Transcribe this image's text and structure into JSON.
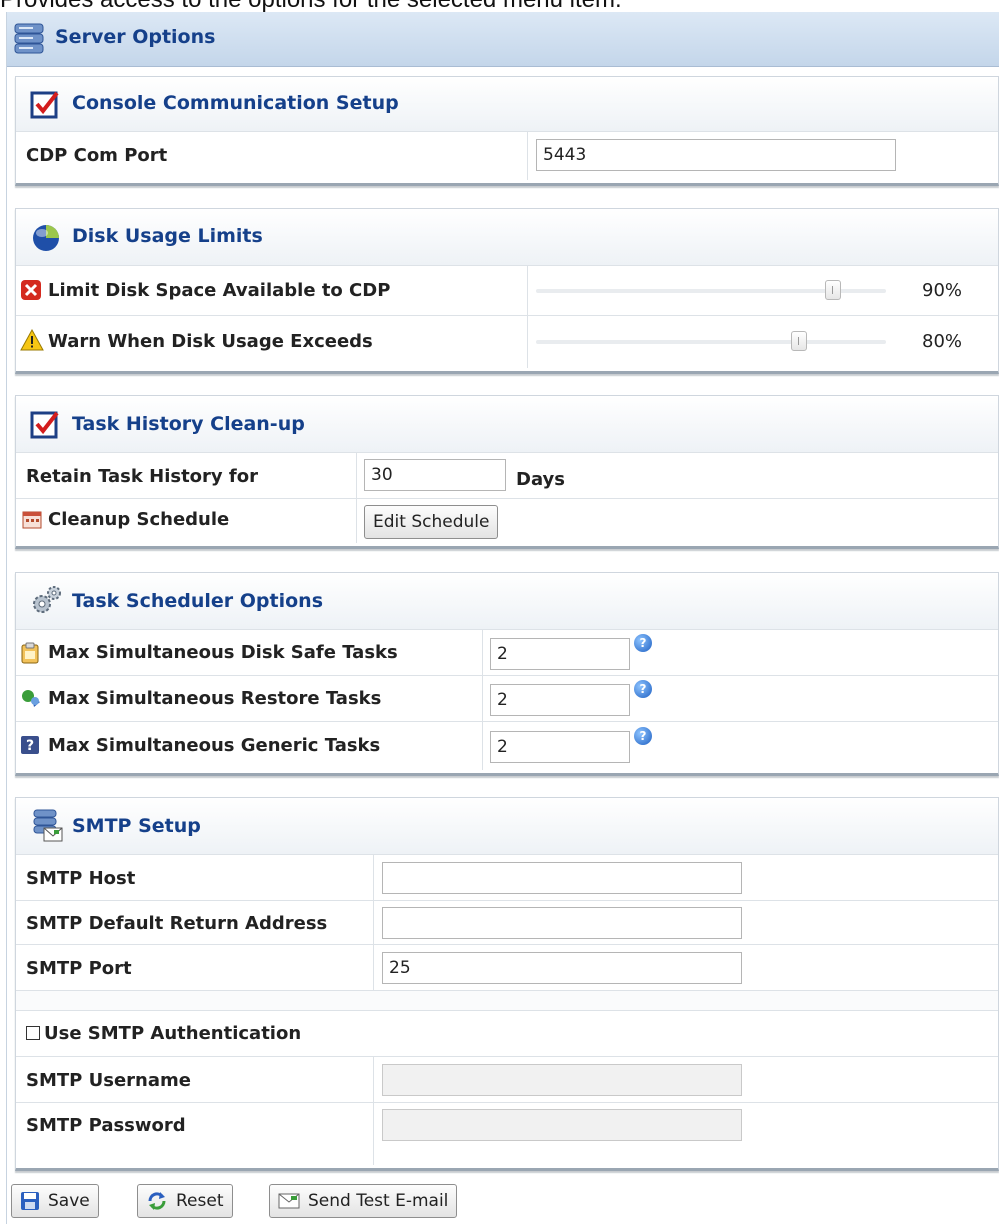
{
  "caption": "Provides access to the options for the selected menu item.",
  "panel": {
    "title": "Server Options"
  },
  "console": {
    "title": "Console Communication Setup",
    "cdp_port_label": "CDP Com Port",
    "cdp_port_value": "5443"
  },
  "disk": {
    "title": "Disk Usage Limits",
    "limit_label": "Limit Disk Space Available to CDP",
    "limit_value": "90%",
    "limit_fraction": 0.9,
    "warn_label": "Warn When Disk Usage Exceeds",
    "warn_value": "80%",
    "warn_fraction": 0.8
  },
  "history": {
    "title": "Task History Clean-up",
    "retain_label": "Retain Task History for",
    "retain_value": "30",
    "retain_unit": "Days",
    "cleanup_label": "Cleanup Schedule",
    "edit_button": "Edit Schedule"
  },
  "scheduler": {
    "title": "Task Scheduler Options",
    "disk_safe_label": "Max Simultaneous Disk Safe Tasks",
    "disk_safe_value": "2",
    "restore_label": "Max Simultaneous Restore Tasks",
    "restore_value": "2",
    "generic_label": "Max Simultaneous Generic Tasks",
    "generic_value": "2",
    "help_glyph": "?"
  },
  "smtp": {
    "title": "SMTP Setup",
    "host_label": "SMTP Host",
    "host_value": "",
    "return_label": "SMTP Default Return Address",
    "return_value": "",
    "port_label": "SMTP Port",
    "port_value": "25",
    "auth_label": "Use SMTP Authentication",
    "auth_checked": false,
    "username_label": "SMTP Username",
    "username_value": "",
    "password_label": "SMTP Password",
    "password_value": ""
  },
  "footer": {
    "save_label": "Save",
    "reset_label": "Reset",
    "test_label": "Send Test E-mail"
  }
}
